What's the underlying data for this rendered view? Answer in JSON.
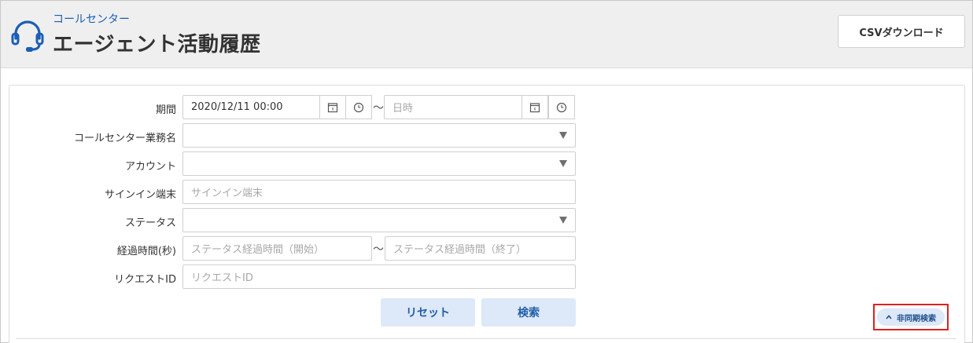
{
  "header": {
    "breadcrumb": "コールセンター",
    "title": "エージェント活動履歴",
    "csv_button": "CSVダウンロード"
  },
  "form": {
    "period": {
      "label": "期間",
      "start_value": "2020/12/11 00:00",
      "separator": "～",
      "end_placeholder": "日時"
    },
    "callcenter_job": {
      "label": "コールセンター業務名",
      "value": ""
    },
    "account": {
      "label": "アカウント",
      "value": ""
    },
    "signin_terminal": {
      "label": "サインイン端末",
      "placeholder": "サインイン端末"
    },
    "status": {
      "label": "ステータス",
      "value": ""
    },
    "elapsed": {
      "label": "経過時間(秒)",
      "start_placeholder": "ステータス経過時間（開始）",
      "separator": "～",
      "end_placeholder": "ステータス経過時間（終了）"
    },
    "request_id": {
      "label": "リクエストID",
      "placeholder": "リクエストID"
    }
  },
  "actions": {
    "reset": "リセット",
    "search": "検索",
    "async_search": "非同期検索"
  },
  "icons": {
    "header": "headset-icon",
    "calendar": "calendar-icon",
    "clock": "clock-icon",
    "dropdown": "caret-down-icon",
    "async": "chevron-up-icon"
  },
  "colors": {
    "accent": "#1a5fb4",
    "button_bg": "#dde8f8",
    "highlight": "#e02020"
  }
}
